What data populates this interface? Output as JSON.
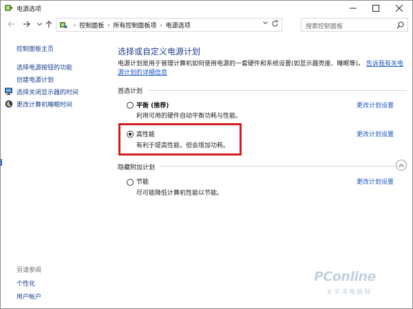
{
  "window": {
    "title": "电源选项",
    "minimize_icon": "minimize-icon",
    "maximize_icon": "maximize-icon",
    "close_icon": "close-icon"
  },
  "address": {
    "breadcrumbs": [
      "控制面板",
      "所有控制面板项",
      "电源选项"
    ],
    "search_placeholder": "搜索控制面板"
  },
  "sidebar": {
    "home": "控制面板主页",
    "items": [
      {
        "label": "选择电源按钮的功能",
        "icon": null
      },
      {
        "label": "创建电源计划",
        "icon": null
      },
      {
        "label": "选择关闭显示器的时间",
        "icon": "monitor-icon"
      },
      {
        "label": "更改计算机睡眠时间",
        "icon": "moon-icon"
      }
    ],
    "see_also": "另请参阅",
    "see_also_items": [
      "个性化",
      "用户帐户"
    ]
  },
  "main": {
    "title": "选择或自定义电源计划",
    "description": "电源计划是用于管理计算机如何使用电源的一套硬件和系统设置(如显示器亮度、睡眠等)。",
    "description_link": "告诉我有关电源计划的详细信息",
    "preferred_label": "首选计划",
    "hidden_label": "隐藏附加计划",
    "change_label": "更改计划设置",
    "plans": [
      {
        "name": "平衡",
        "tag": " (推荐)",
        "desc": "利用可用的硬件自动平衡功耗与性能。",
        "selected": false
      },
      {
        "name": "高性能",
        "tag": "",
        "desc": "有利于提高性能，但会增加功耗。",
        "selected": true
      },
      {
        "name": "节能",
        "tag": "",
        "desc": "尽可能降低计算机性能以节能。",
        "selected": false
      }
    ]
  },
  "watermark": {
    "brand": "PConline",
    "sub": "太平洋电脑网"
  },
  "colors": {
    "link": "#1c56c5",
    "title": "#1e3c8c",
    "highlight": "#d11c20"
  }
}
